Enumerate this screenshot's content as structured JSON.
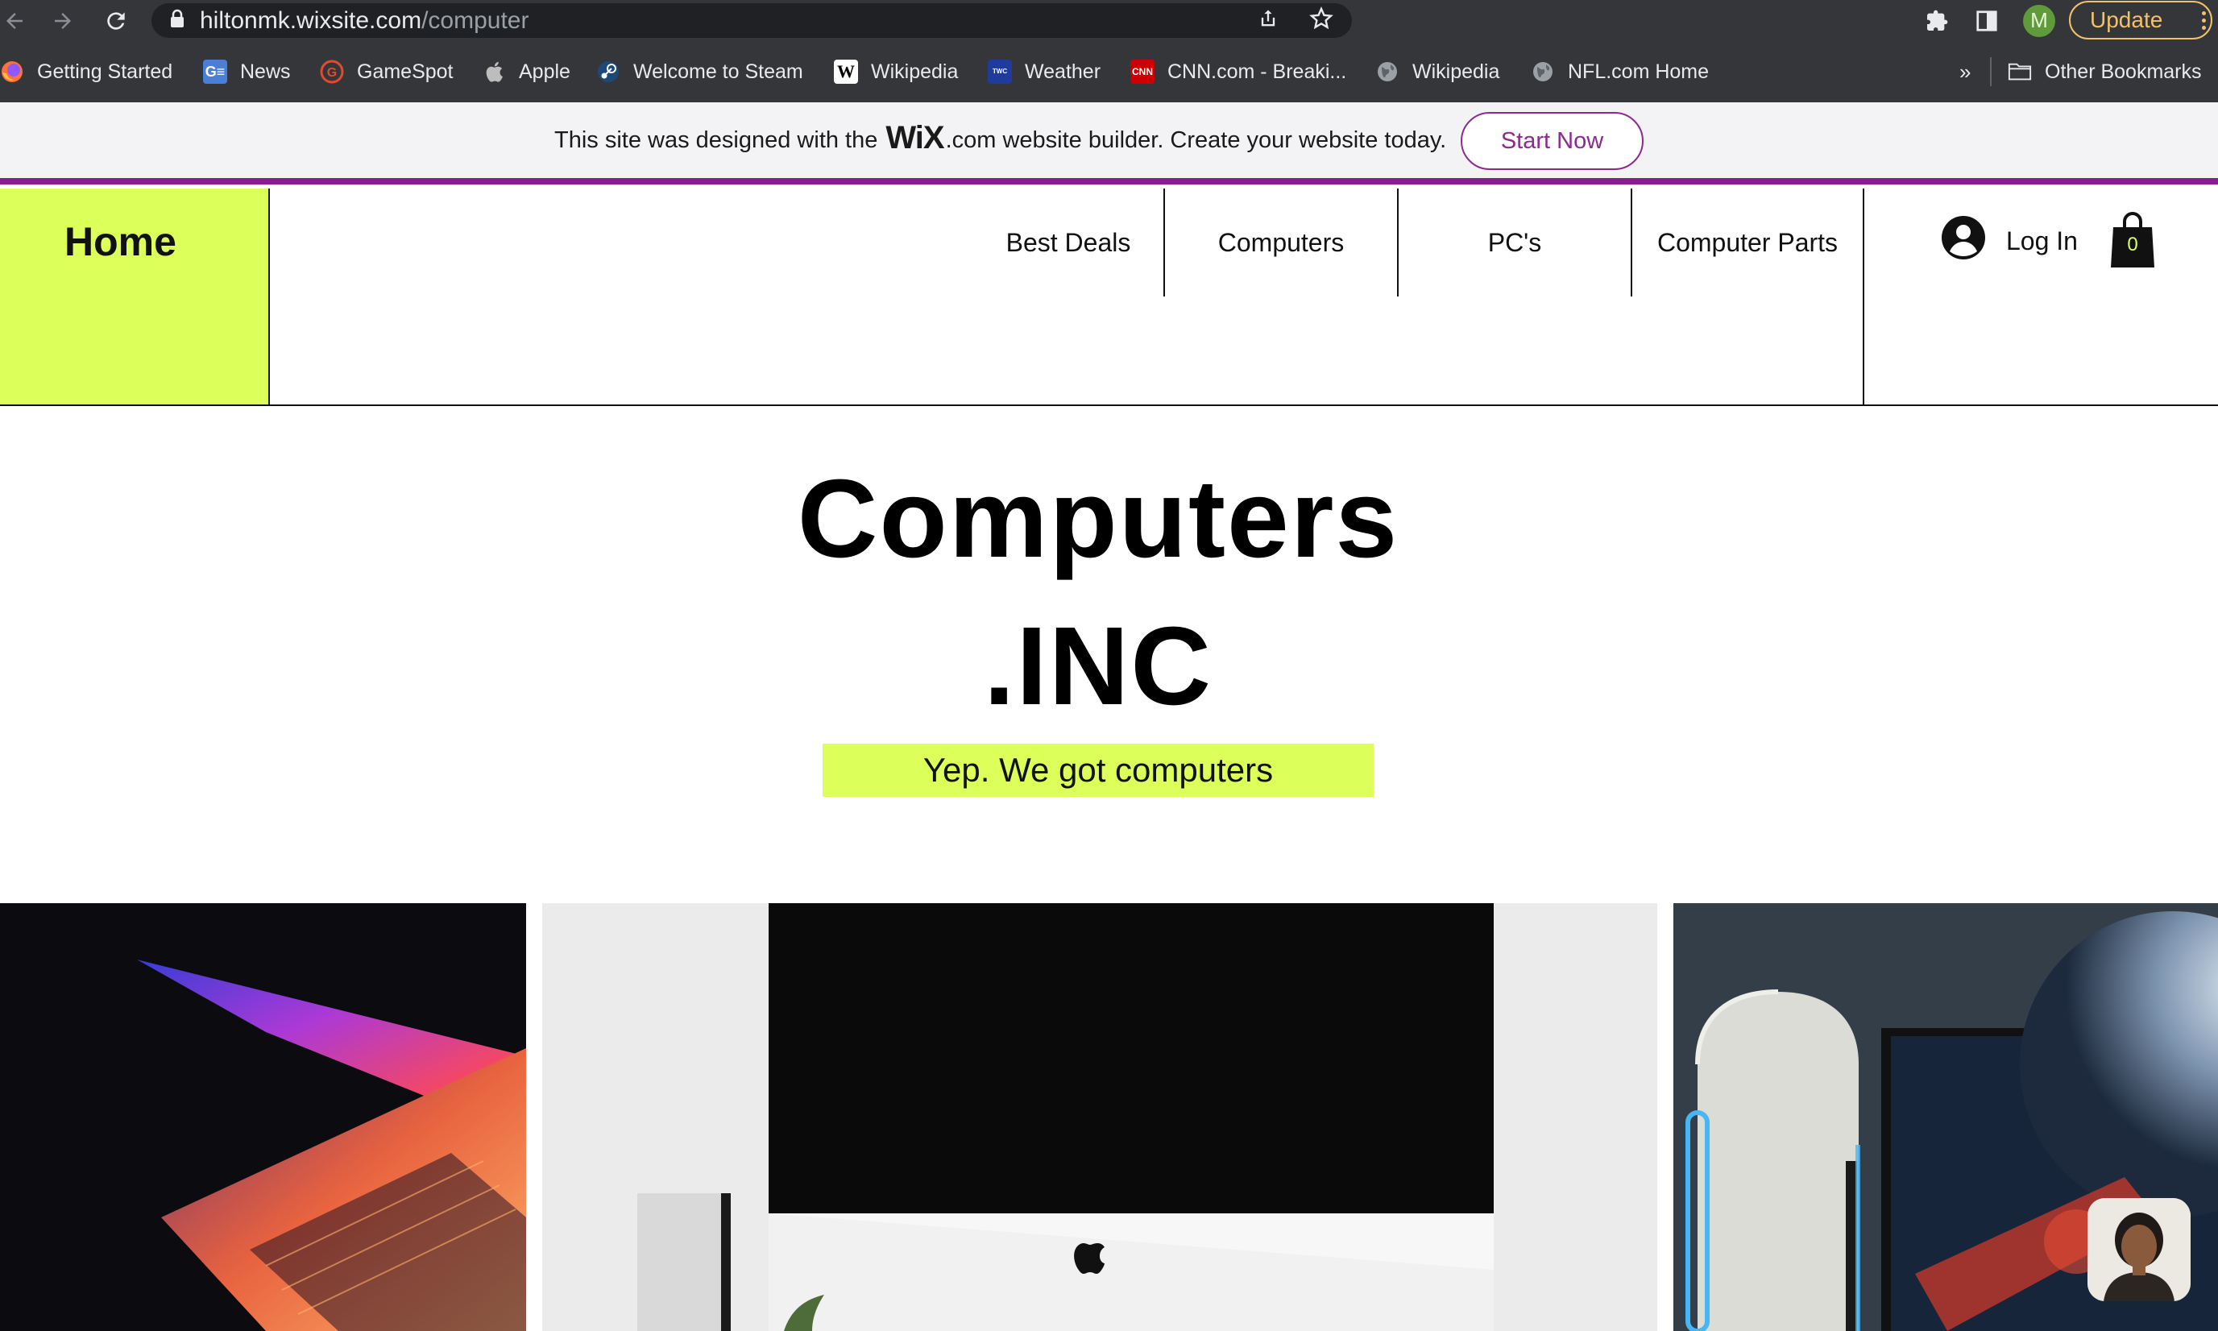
{
  "browser": {
    "url_host": "hiltonmk.wixsite.com",
    "url_path": "/computer",
    "profile_initial": "M",
    "update_label": "Update",
    "icons": [
      "back-arrow-icon",
      "forward-arrow-icon",
      "reload-icon",
      "lock-icon",
      "share-icon",
      "star-icon",
      "extensions-icon",
      "sidebar-icon",
      "more-icon"
    ]
  },
  "bookmarks": {
    "items": [
      {
        "label": "Getting Started",
        "icon": "firefox-icon"
      },
      {
        "label": "News",
        "icon": "google-news-icon"
      },
      {
        "label": "GameSpot",
        "icon": "gamespot-icon"
      },
      {
        "label": "Apple",
        "icon": "apple-icon"
      },
      {
        "label": "Welcome to Steam",
        "icon": "steam-icon"
      },
      {
        "label": "Wikipedia",
        "icon": "wikipedia-icon"
      },
      {
        "label": "Weather",
        "icon": "weather-channel-icon"
      },
      {
        "label": "CNN.com - Breaki...",
        "icon": "cnn-icon"
      },
      {
        "label": "Wikipedia",
        "icon": "globe-icon"
      },
      {
        "label": "NFL.com Home",
        "icon": "globe-icon"
      }
    ],
    "overflow_label": "»",
    "other_label": "Other Bookmarks"
  },
  "wix_banner": {
    "text_before": "This site was designed with the",
    "logo": "WiX",
    "text_after": ".com website builder. Create your website today.",
    "cta": "Start Now"
  },
  "site": {
    "home_label": "Home",
    "nav": [
      "Best Deals",
      "Computers",
      "PC's",
      "Computer Parts"
    ],
    "login_label": "Log In",
    "cart_count": "0",
    "hero_title": "Computers",
    "hero_subtitle": ".INC",
    "tagline": "Yep. We got computers"
  },
  "colors": {
    "accent_lime": "#ddff5a",
    "wix_purple": "#8d2a8f",
    "chrome_dark": "#35363a"
  }
}
